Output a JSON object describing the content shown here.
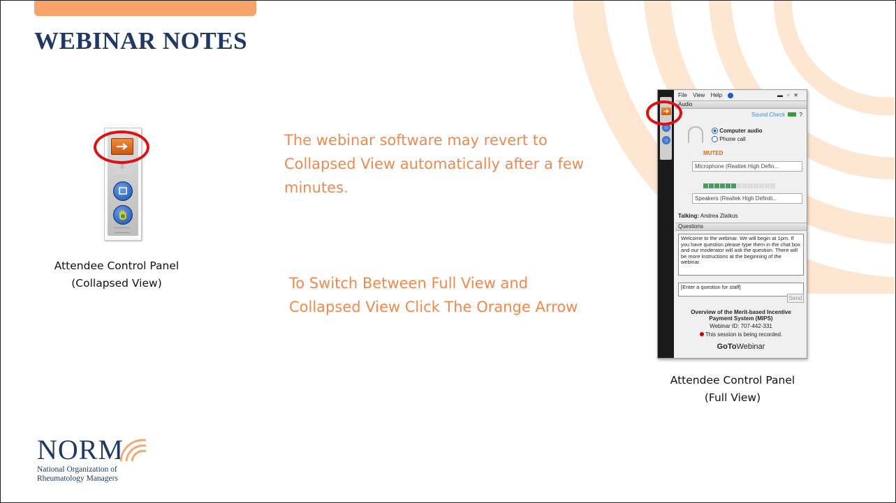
{
  "slide": {
    "title": "WEBINAR NOTES",
    "body_text_1": "The webinar software may revert to Collapsed View automatically after a few minutes.",
    "body_text_2": "To Switch Between Full View and Collapsed View Click The Orange Arrow",
    "caption_collapsed_line1": "Attendee Control Panel",
    "caption_collapsed_line2": "(Collapsed View)",
    "caption_full_line1": "Attendee Control Panel",
    "caption_full_line2": "(Full View)",
    "accent_color": "#ee8a4e",
    "title_color": "#1f3864"
  },
  "logo": {
    "wordmark": "NORM",
    "line1": "National Organization of",
    "line2": "Rheumatology Managers"
  },
  "panel": {
    "menu": [
      "File",
      "View",
      "Help"
    ],
    "audio_header": "Audio",
    "sound_check": "Sound Check",
    "help_mark": "?",
    "radio_computer": "Computer audio",
    "radio_phone": "Phone call",
    "muted": "MUTED",
    "microphone": "Microphone (Realtek High Defin...",
    "speakers": "Speakers (Realtek High Definiti...",
    "talking_label": "Talking:",
    "talking_name": "Andrea Zlatkus",
    "questions_header": "Questions",
    "welcome_message": "Welcome to the webinar. We will begin at 1pm. If you have question please type them in the chat box and our moderator will ask the question. There will be more instructions at the beginning of the webinar.",
    "question_placeholder": "[Enter a question for staff]",
    "send_label": "Send",
    "webinar_title": "Overview of the Merit-based Incentive Payment System (MIPS)",
    "webinar_id": "Webinar ID: 707-442-331",
    "recording_notice": "This session is being recorded.",
    "brand_bold": "GoTo",
    "brand_rest": "Webinar"
  }
}
